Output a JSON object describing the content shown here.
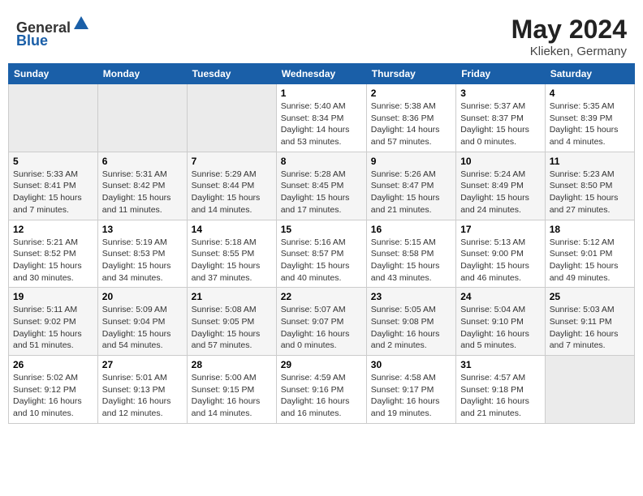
{
  "header": {
    "logo_general": "General",
    "logo_blue": "Blue",
    "title": "May 2024",
    "location": "Klieken, Germany"
  },
  "days_of_week": [
    "Sunday",
    "Monday",
    "Tuesday",
    "Wednesday",
    "Thursday",
    "Friday",
    "Saturday"
  ],
  "weeks": [
    [
      {
        "day": "",
        "info": ""
      },
      {
        "day": "",
        "info": ""
      },
      {
        "day": "",
        "info": ""
      },
      {
        "day": "1",
        "info": "Sunrise: 5:40 AM\nSunset: 8:34 PM\nDaylight: 14 hours\nand 53 minutes."
      },
      {
        "day": "2",
        "info": "Sunrise: 5:38 AM\nSunset: 8:36 PM\nDaylight: 14 hours\nand 57 minutes."
      },
      {
        "day": "3",
        "info": "Sunrise: 5:37 AM\nSunset: 8:37 PM\nDaylight: 15 hours\nand 0 minutes."
      },
      {
        "day": "4",
        "info": "Sunrise: 5:35 AM\nSunset: 8:39 PM\nDaylight: 15 hours\nand 4 minutes."
      }
    ],
    [
      {
        "day": "5",
        "info": "Sunrise: 5:33 AM\nSunset: 8:41 PM\nDaylight: 15 hours\nand 7 minutes."
      },
      {
        "day": "6",
        "info": "Sunrise: 5:31 AM\nSunset: 8:42 PM\nDaylight: 15 hours\nand 11 minutes."
      },
      {
        "day": "7",
        "info": "Sunrise: 5:29 AM\nSunset: 8:44 PM\nDaylight: 15 hours\nand 14 minutes."
      },
      {
        "day": "8",
        "info": "Sunrise: 5:28 AM\nSunset: 8:45 PM\nDaylight: 15 hours\nand 17 minutes."
      },
      {
        "day": "9",
        "info": "Sunrise: 5:26 AM\nSunset: 8:47 PM\nDaylight: 15 hours\nand 21 minutes."
      },
      {
        "day": "10",
        "info": "Sunrise: 5:24 AM\nSunset: 8:49 PM\nDaylight: 15 hours\nand 24 minutes."
      },
      {
        "day": "11",
        "info": "Sunrise: 5:23 AM\nSunset: 8:50 PM\nDaylight: 15 hours\nand 27 minutes."
      }
    ],
    [
      {
        "day": "12",
        "info": "Sunrise: 5:21 AM\nSunset: 8:52 PM\nDaylight: 15 hours\nand 30 minutes."
      },
      {
        "day": "13",
        "info": "Sunrise: 5:19 AM\nSunset: 8:53 PM\nDaylight: 15 hours\nand 34 minutes."
      },
      {
        "day": "14",
        "info": "Sunrise: 5:18 AM\nSunset: 8:55 PM\nDaylight: 15 hours\nand 37 minutes."
      },
      {
        "day": "15",
        "info": "Sunrise: 5:16 AM\nSunset: 8:57 PM\nDaylight: 15 hours\nand 40 minutes."
      },
      {
        "day": "16",
        "info": "Sunrise: 5:15 AM\nSunset: 8:58 PM\nDaylight: 15 hours\nand 43 minutes."
      },
      {
        "day": "17",
        "info": "Sunrise: 5:13 AM\nSunset: 9:00 PM\nDaylight: 15 hours\nand 46 minutes."
      },
      {
        "day": "18",
        "info": "Sunrise: 5:12 AM\nSunset: 9:01 PM\nDaylight: 15 hours\nand 49 minutes."
      }
    ],
    [
      {
        "day": "19",
        "info": "Sunrise: 5:11 AM\nSunset: 9:02 PM\nDaylight: 15 hours\nand 51 minutes."
      },
      {
        "day": "20",
        "info": "Sunrise: 5:09 AM\nSunset: 9:04 PM\nDaylight: 15 hours\nand 54 minutes."
      },
      {
        "day": "21",
        "info": "Sunrise: 5:08 AM\nSunset: 9:05 PM\nDaylight: 15 hours\nand 57 minutes."
      },
      {
        "day": "22",
        "info": "Sunrise: 5:07 AM\nSunset: 9:07 PM\nDaylight: 16 hours\nand 0 minutes."
      },
      {
        "day": "23",
        "info": "Sunrise: 5:05 AM\nSunset: 9:08 PM\nDaylight: 16 hours\nand 2 minutes."
      },
      {
        "day": "24",
        "info": "Sunrise: 5:04 AM\nSunset: 9:10 PM\nDaylight: 16 hours\nand 5 minutes."
      },
      {
        "day": "25",
        "info": "Sunrise: 5:03 AM\nSunset: 9:11 PM\nDaylight: 16 hours\nand 7 minutes."
      }
    ],
    [
      {
        "day": "26",
        "info": "Sunrise: 5:02 AM\nSunset: 9:12 PM\nDaylight: 16 hours\nand 10 minutes."
      },
      {
        "day": "27",
        "info": "Sunrise: 5:01 AM\nSunset: 9:13 PM\nDaylight: 16 hours\nand 12 minutes."
      },
      {
        "day": "28",
        "info": "Sunrise: 5:00 AM\nSunset: 9:15 PM\nDaylight: 16 hours\nand 14 minutes."
      },
      {
        "day": "29",
        "info": "Sunrise: 4:59 AM\nSunset: 9:16 PM\nDaylight: 16 hours\nand 16 minutes."
      },
      {
        "day": "30",
        "info": "Sunrise: 4:58 AM\nSunset: 9:17 PM\nDaylight: 16 hours\nand 19 minutes."
      },
      {
        "day": "31",
        "info": "Sunrise: 4:57 AM\nSunset: 9:18 PM\nDaylight: 16 hours\nand 21 minutes."
      },
      {
        "day": "",
        "info": ""
      }
    ]
  ]
}
